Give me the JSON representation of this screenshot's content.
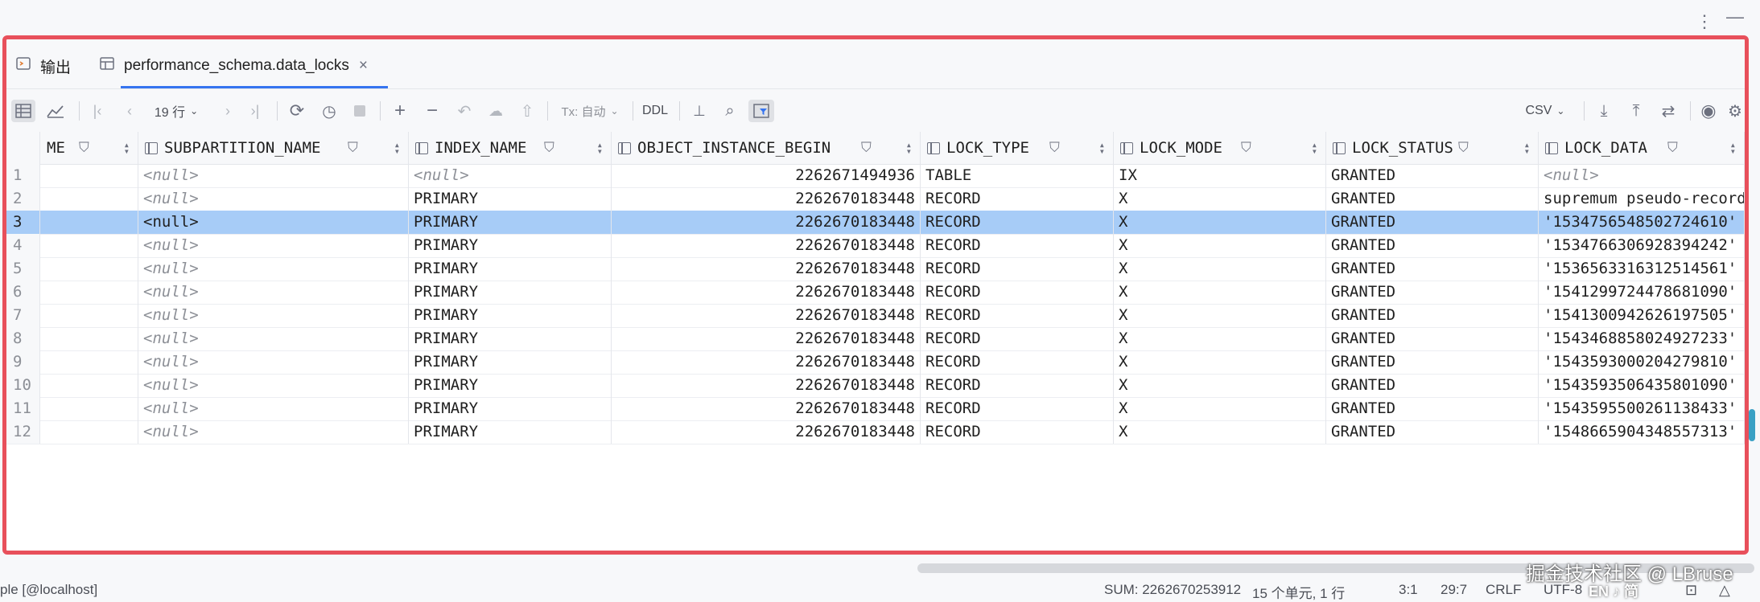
{
  "tabs": [
    {
      "label": "输出",
      "icon": "output-icon"
    },
    {
      "label": "performance_schema.data_locks",
      "icon": "table-icon",
      "close": "×"
    }
  ],
  "toolbar": {
    "rows_label": "19 行",
    "tx_label": "Tx: 自动",
    "ddl_label": "DDL",
    "export_format": "CSV"
  },
  "columns": [
    {
      "name": "ME"
    },
    {
      "name": "SUBPARTITION_NAME"
    },
    {
      "name": "INDEX_NAME"
    },
    {
      "name": "OBJECT_INSTANCE_BEGIN"
    },
    {
      "name": "LOCK_TYPE"
    },
    {
      "name": "LOCK_MODE"
    },
    {
      "name": "LOCK_STATUS"
    },
    {
      "name": "LOCK_DATA"
    }
  ],
  "rows": [
    {
      "n": "1",
      "sub": "<null>",
      "idx": "<null>",
      "obj": "2262671494936",
      "type": "TABLE",
      "mode": "IX",
      "status": "GRANTED",
      "data": "<null>"
    },
    {
      "n": "2",
      "sub": "<null>",
      "idx": "PRIMARY",
      "obj": "2262670183448",
      "type": "RECORD",
      "mode": "X",
      "status": "GRANTED",
      "data": "supremum pseudo-record"
    },
    {
      "n": "3",
      "sub": "<null>",
      "idx": "PRIMARY",
      "obj": "2262670183448",
      "type": "RECORD",
      "mode": "X",
      "status": "GRANTED",
      "data": "'1534756548502724610'"
    },
    {
      "n": "4",
      "sub": "<null>",
      "idx": "PRIMARY",
      "obj": "2262670183448",
      "type": "RECORD",
      "mode": "X",
      "status": "GRANTED",
      "data": "'1534766306928394242'"
    },
    {
      "n": "5",
      "sub": "<null>",
      "idx": "PRIMARY",
      "obj": "2262670183448",
      "type": "RECORD",
      "mode": "X",
      "status": "GRANTED",
      "data": "'1536563316312514561'"
    },
    {
      "n": "6",
      "sub": "<null>",
      "idx": "PRIMARY",
      "obj": "2262670183448",
      "type": "RECORD",
      "mode": "X",
      "status": "GRANTED",
      "data": "'1541299724478681090'"
    },
    {
      "n": "7",
      "sub": "<null>",
      "idx": "PRIMARY",
      "obj": "2262670183448",
      "type": "RECORD",
      "mode": "X",
      "status": "GRANTED",
      "data": "'1541300942626197505'"
    },
    {
      "n": "8",
      "sub": "<null>",
      "idx": "PRIMARY",
      "obj": "2262670183448",
      "type": "RECORD",
      "mode": "X",
      "status": "GRANTED",
      "data": "'1543468858024927233'"
    },
    {
      "n": "9",
      "sub": "<null>",
      "idx": "PRIMARY",
      "obj": "2262670183448",
      "type": "RECORD",
      "mode": "X",
      "status": "GRANTED",
      "data": "'1543593000204279810'"
    },
    {
      "n": "10",
      "sub": "<null>",
      "idx": "PRIMARY",
      "obj": "2262670183448",
      "type": "RECORD",
      "mode": "X",
      "status": "GRANTED",
      "data": "'1543593506435801090'"
    },
    {
      "n": "11",
      "sub": "<null>",
      "idx": "PRIMARY",
      "obj": "2262670183448",
      "type": "RECORD",
      "mode": "X",
      "status": "GRANTED",
      "data": "'1543595500261138433'"
    },
    {
      "n": "12",
      "sub": "<null>",
      "idx": "PRIMARY",
      "obj": "2262670183448",
      "type": "RECORD",
      "mode": "X",
      "status": "GRANTED",
      "data": "'1548665904348557313'"
    }
  ],
  "selected_row": "3",
  "status_bar": {
    "left": "ple [@localhost]",
    "sum": "SUM: 2262670253912",
    "cells": "15 个单元, 1 行",
    "pos1": "3:1",
    "pos2": "29:7",
    "line_ending": "CRLF",
    "encoding": "UTF-8"
  },
  "watermark": "掘金技术社区 @ LBruse",
  "ime": "EN ♪ 简",
  "colors": {
    "frame": "#e8505b",
    "selection": "#a7ccf7",
    "accent": "#3574f0"
  }
}
